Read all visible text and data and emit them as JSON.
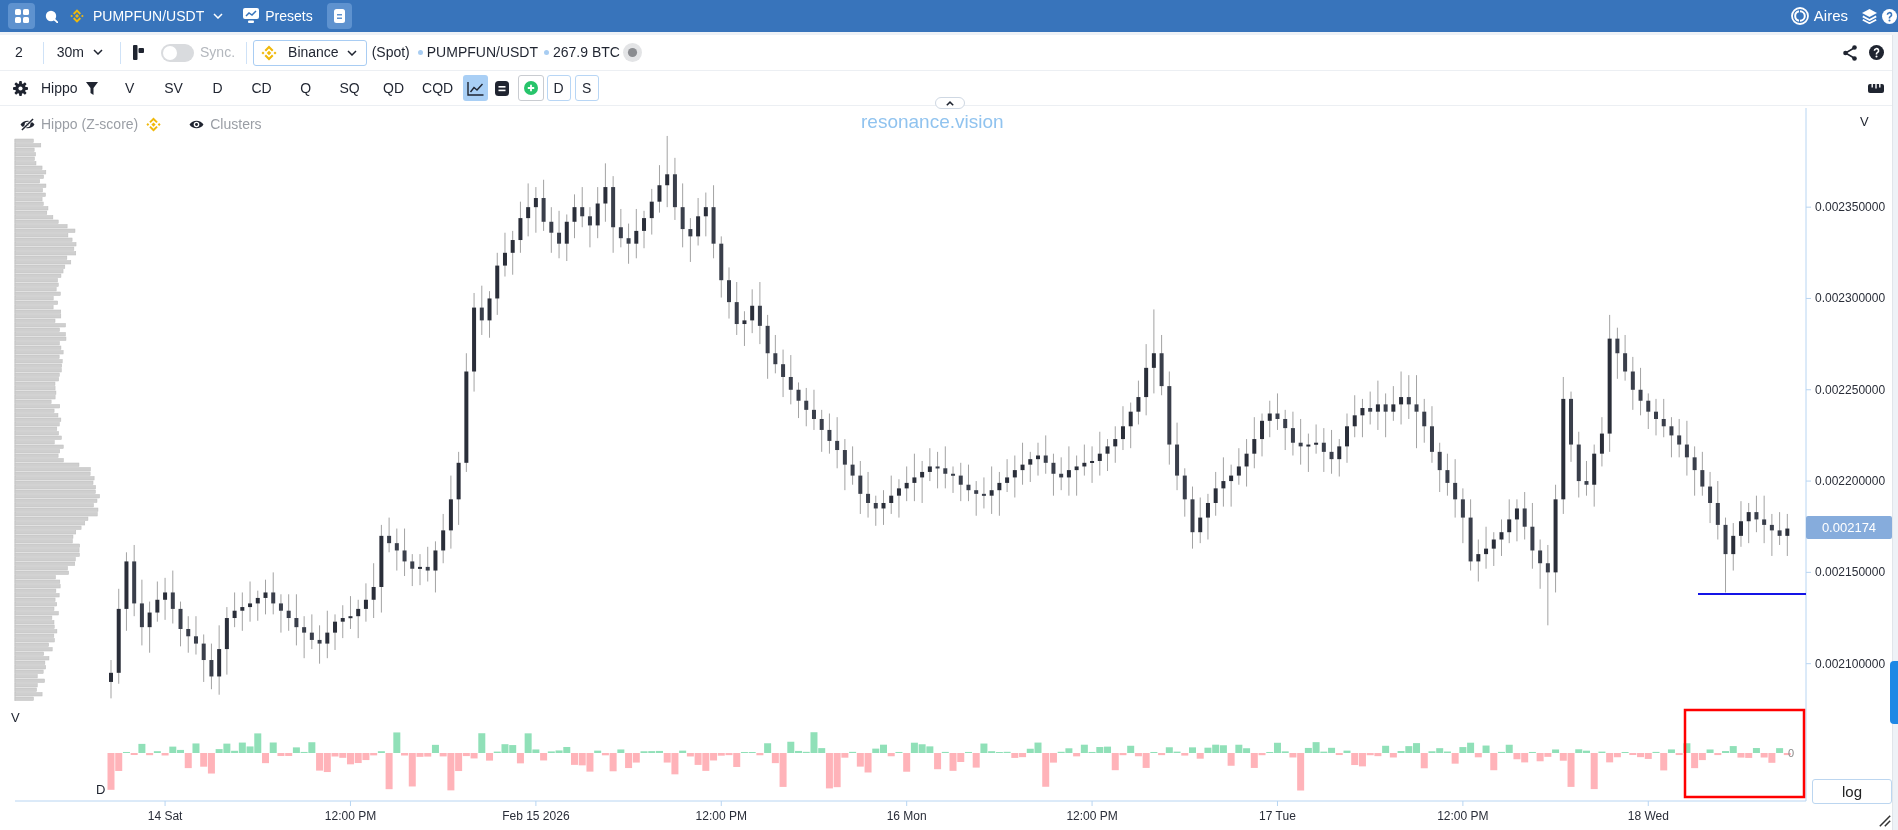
{
  "top_bar": {
    "symbol": "PUMPFUN/USDT",
    "presets": "Presets",
    "user": "Aires"
  },
  "toolbar": {
    "layout_count": "2",
    "interval": "30m",
    "sync": {
      "label": "Sync.",
      "on": false
    },
    "exchange": "Binance",
    "market": "(Spot)",
    "pair": "PUMPFUN/USDT",
    "volume": "267.9 BTC"
  },
  "indicator_bar": {
    "preset": "Hippo",
    "metrics": [
      {
        "label": "V",
        "selected": false
      },
      {
        "label": "SV",
        "selected": false
      },
      {
        "label": "D",
        "selected": false
      },
      {
        "label": "CD",
        "selected": false
      },
      {
        "label": "Q",
        "selected": false
      },
      {
        "label": "SQ",
        "selected": false
      },
      {
        "label": "QD",
        "selected": false
      },
      {
        "label": "CQD",
        "selected": false
      }
    ],
    "line_chart_selected": true,
    "pane_buttons": [
      "D",
      "S"
    ]
  },
  "chart": {
    "legend": [
      {
        "label": "Hippo (Z-score)",
        "visible": false,
        "exchange_logo": true
      },
      {
        "label": "Clusters",
        "visible": true,
        "exchange_logo": false
      }
    ],
    "brand": "resonance.vision",
    "price_scale_label": "V",
    "last_price": "0.002174",
    "profile_label": "V",
    "delta_label": "D",
    "delta_zero": "0",
    "scale_button": "log",
    "chart_data": {
      "type": "candlestick",
      "ylim": [
        0.0020248,
        0.0024043
      ],
      "yticks": [
        {
          "value": 0.00235,
          "label": "0.002350000"
        },
        {
          "value": 0.0023,
          "label": "0.002300000"
        },
        {
          "value": 0.00225,
          "label": "0.002250000"
        },
        {
          "value": 0.0022,
          "label": "0.002200000"
        },
        {
          "value": 0.00215,
          "label": "0.002150000"
        },
        {
          "value": 0.0021,
          "label": "0.002100000"
        }
      ],
      "categories": [
        null,
        null,
        null,
        null,
        null,
        null,
        null,
        "14 Sat",
        null,
        null,
        null,
        null,
        null,
        null,
        null,
        null,
        null,
        null,
        null,
        null,
        null,
        null,
        null,
        null,
        null,
        null,
        null,
        null,
        null,
        null,
        null,
        "12:00 PM",
        null,
        null,
        null,
        null,
        null,
        null,
        null,
        null,
        null,
        null,
        null,
        null,
        null,
        null,
        null,
        null,
        null,
        null,
        null,
        null,
        null,
        null,
        null,
        "Feb 15 2026",
        null,
        null,
        null,
        null,
        null,
        null,
        null,
        null,
        null,
        null,
        null,
        null,
        null,
        null,
        null,
        null,
        null,
        null,
        null,
        null,
        null,
        null,
        null,
        "12:00 PM",
        null,
        null,
        null,
        null,
        null,
        null,
        null,
        null,
        null,
        null,
        null,
        null,
        null,
        null,
        null,
        null,
        null,
        null,
        null,
        null,
        null,
        null,
        null,
        "16 Mon",
        null,
        null,
        null,
        null,
        null,
        null,
        null,
        null,
        null,
        null,
        null,
        null,
        null,
        null,
        null,
        null,
        null,
        null,
        null,
        null,
        null,
        null,
        null,
        "12:00 PM",
        null,
        null,
        null,
        null,
        null,
        null,
        null,
        null,
        null,
        null,
        null,
        null,
        null,
        null,
        null,
        null,
        null,
        null,
        null,
        null,
        null,
        null,
        null,
        "17 Tue",
        null,
        null,
        null,
        null,
        null,
        null,
        null,
        null,
        null,
        null,
        null,
        null,
        null,
        null,
        null,
        null,
        null,
        null,
        null,
        null,
        null,
        null,
        null,
        "12:00 PM",
        null,
        null,
        null,
        null,
        null,
        null,
        null,
        null,
        null,
        null,
        null,
        null,
        null,
        null,
        null,
        null,
        null,
        null,
        null,
        null,
        null,
        null,
        null,
        "18 Wed",
        null,
        null,
        null,
        null,
        null,
        null,
        null,
        null,
        null,
        null,
        null,
        null,
        null,
        null,
        null,
        null,
        null,
        null
      ],
      "ohlc": [
        [
          0.00209,
          0.002102,
          0.002081,
          0.002095
        ],
        [
          0.002095,
          0.002141,
          0.002089,
          0.00213
        ],
        [
          0.00213,
          0.002161,
          0.002118,
          0.002156
        ],
        [
          0.002156,
          0.002165,
          0.002126,
          0.002133
        ],
        [
          0.002133,
          0.002146,
          0.00211,
          0.00212
        ],
        [
          0.00212,
          0.002134,
          0.002106,
          0.002128
        ],
        [
          0.002128,
          0.002145,
          0.002123,
          0.002135
        ],
        [
          0.002135,
          0.002147,
          0.002124,
          0.002139
        ],
        [
          0.002139,
          0.002151,
          0.002122,
          0.00213
        ],
        [
          0.00213,
          0.002134,
          0.0021095,
          0.002119
        ],
        [
          0.002119,
          0.002126,
          0.002106,
          0.002115
        ],
        [
          0.002115,
          0.002126,
          0.002105,
          0.002111
        ],
        [
          0.002111,
          0.002116,
          0.00209,
          0.002102
        ],
        [
          0.002102,
          0.002111,
          0.002086,
          0.002093
        ],
        [
          0.002093,
          0.002121,
          0.002083,
          0.002108
        ],
        [
          0.002108,
          0.002131,
          0.002094,
          0.002125
        ],
        [
          0.002125,
          0.002139,
          0.00212,
          0.002129
        ],
        [
          0.002129,
          0.002139,
          0.002118,
          0.002131
        ],
        [
          0.002131,
          0.002145,
          0.002123,
          0.002133
        ],
        [
          0.002133,
          0.00214,
          0.0021235,
          0.002136
        ],
        [
          0.002136,
          0.002146,
          0.002127,
          0.002139
        ],
        [
          0.002139,
          0.00215,
          0.002127,
          0.002133
        ],
        [
          0.002133,
          0.002138,
          0.002117,
          0.002129
        ],
        [
          0.002129,
          0.002138,
          0.002118,
          0.002125
        ],
        [
          0.002125,
          0.002138,
          0.00211,
          0.00212
        ],
        [
          0.00212,
          0.002126,
          0.002103,
          0.002117
        ],
        [
          0.002117,
          0.002127,
          0.002108,
          0.002113
        ],
        [
          0.002113,
          0.002121,
          0.0021,
          0.002111
        ],
        [
          0.002111,
          0.002129,
          0.002103,
          0.002117
        ],
        [
          0.002117,
          0.002127,
          0.0021075,
          0.002123
        ],
        [
          0.002123,
          0.002132,
          0.002114,
          0.002125
        ],
        [
          0.002125,
          0.002137,
          0.002119,
          0.002126
        ],
        [
          0.002126,
          0.002135,
          0.002114,
          0.00213
        ],
        [
          0.00213,
          0.002144,
          0.002123,
          0.002135
        ],
        [
          0.002135,
          0.002155,
          0.002125,
          0.002142
        ],
        [
          0.002142,
          0.002176,
          0.002128,
          0.00217
        ],
        [
          0.00217,
          0.00218,
          0.002161,
          0.002166
        ],
        [
          0.002166,
          0.002174,
          0.002151,
          0.002162
        ],
        [
          0.002162,
          0.002174,
          0.002148,
          0.002156
        ],
        [
          0.002156,
          0.00216,
          0.0021425,
          0.002152
        ],
        [
          0.002152,
          0.00216,
          0.002143,
          0.002153
        ],
        [
          0.002153,
          0.002164,
          0.002145,
          0.002151
        ],
        [
          0.002151,
          0.002167,
          0.002139,
          0.002162
        ],
        [
          0.002162,
          0.002182,
          0.002155,
          0.002173
        ],
        [
          0.002173,
          0.002203,
          0.002163,
          0.00219
        ],
        [
          0.00219,
          0.002216,
          0.002176,
          0.00221
        ],
        [
          0.00221,
          0.00227,
          0.002205,
          0.00226
        ],
        [
          0.00226,
          0.002303,
          0.002249,
          0.002295
        ],
        [
          0.002295,
          0.002307,
          0.00228,
          0.002288
        ],
        [
          0.002288,
          0.002304,
          0.0022785,
          0.0023
        ],
        [
          0.0023,
          0.002325,
          0.002291,
          0.002318
        ],
        [
          0.002318,
          0.002336,
          0.002312,
          0.002325
        ],
        [
          0.002325,
          0.002337,
          0.002313,
          0.002332
        ],
        [
          0.002332,
          0.002353,
          0.002325,
          0.002344
        ],
        [
          0.002344,
          0.002363,
          0.002334,
          0.00235
        ],
        [
          0.00235,
          0.002361,
          0.002336,
          0.002355
        ],
        [
          0.002355,
          0.002365,
          0.002337,
          0.002342
        ],
        [
          0.002342,
          0.00235,
          0.002325,
          0.002336
        ],
        [
          0.002336,
          0.002348,
          0.002322,
          0.00233
        ],
        [
          0.00233,
          0.002346,
          0.0023205,
          0.002342
        ],
        [
          0.002342,
          0.002357,
          0.002333,
          0.00235
        ],
        [
          0.00235,
          0.002361,
          0.002339,
          0.002345
        ],
        [
          0.002345,
          0.00235,
          0.002328,
          0.00234
        ],
        [
          0.00234,
          0.002361,
          0.002333,
          0.002352
        ],
        [
          0.002352,
          0.002374,
          0.002342,
          0.002361
        ],
        [
          0.002361,
          0.002367,
          0.002325,
          0.002339
        ],
        [
          0.002339,
          0.002349,
          0.002328,
          0.002333
        ],
        [
          0.002333,
          0.002341,
          0.002319,
          0.00233
        ],
        [
          0.00233,
          0.002349,
          0.002322,
          0.002337
        ],
        [
          0.002337,
          0.002348,
          0.0023275,
          0.002344
        ],
        [
          0.002344,
          0.00236,
          0.002335,
          0.002353
        ],
        [
          0.002353,
          0.002373,
          0.002347,
          0.002362
        ],
        [
          0.002362,
          0.002389,
          0.00235,
          0.002368
        ],
        [
          0.002368,
          0.002377,
          0.002343,
          0.00235
        ],
        [
          0.00235,
          0.002363,
          0.002328,
          0.002338
        ],
        [
          0.002338,
          0.002344,
          0.00232,
          0.002334
        ],
        [
          0.002334,
          0.002355,
          0.002329,
          0.002345
        ],
        [
          0.002345,
          0.002358,
          0.002334,
          0.00235
        ],
        [
          0.00235,
          0.002362,
          0.002322,
          0.00233
        ],
        [
          0.00233,
          0.002334,
          0.0023005,
          0.00231
        ],
        [
          0.00231,
          0.002317,
          0.002289,
          0.002298
        ],
        [
          0.002298,
          0.002309,
          0.00228,
          0.002286
        ],
        [
          0.002286,
          0.002293,
          0.002274,
          0.002288
        ],
        [
          0.002288,
          0.002305,
          0.002281,
          0.002296
        ],
        [
          0.002296,
          0.002309,
          0.002275,
          0.002285
        ],
        [
          0.002285,
          0.002291,
          0.002256,
          0.00227
        ],
        [
          0.00227,
          0.00228,
          0.002259,
          0.002264
        ],
        [
          0.002264,
          0.002272,
          0.002246,
          0.002257
        ],
        [
          0.002257,
          0.002269,
          0.002242,
          0.00225
        ],
        [
          0.00225,
          0.002254,
          0.0022345,
          0.002244
        ],
        [
          0.002244,
          0.002251,
          0.00223,
          0.002239
        ],
        [
          0.002239,
          0.00225,
          0.002228,
          0.002234
        ],
        [
          0.002234,
          0.002239,
          0.002216,
          0.002228
        ],
        [
          0.002228,
          0.002237,
          0.002215,
          0.002222
        ],
        [
          0.002222,
          0.002235,
          0.002207,
          0.002217
        ],
        [
          0.002217,
          0.002223,
          0.002195,
          0.002209
        ],
        [
          0.002209,
          0.002219,
          0.002198,
          0.002203
        ],
        [
          0.002203,
          0.002211,
          0.002182,
          0.002193
        ],
        [
          0.002193,
          0.002205,
          0.00218,
          0.002188
        ],
        [
          0.002188,
          0.002192,
          0.0021755,
          0.002185
        ],
        [
          0.002185,
          0.002195,
          0.002176,
          0.002188
        ],
        [
          0.002188,
          0.002203,
          0.002182,
          0.002192
        ],
        [
          0.002192,
          0.002201,
          0.00218,
          0.002196
        ],
        [
          0.002196,
          0.002208,
          0.002189,
          0.002199
        ],
        [
          0.002199,
          0.002215,
          0.002189,
          0.002202
        ],
        [
          0.002202,
          0.002211,
          0.002188,
          0.002205
        ],
        [
          0.002205,
          0.002218,
          0.0022,
          0.002208
        ],
        [
          0.002208,
          0.002216,
          0.002196,
          0.002207
        ],
        [
          0.002207,
          0.002219,
          0.002196,
          0.002204
        ],
        [
          0.002204,
          0.002208,
          0.0021935,
          0.002203
        ],
        [
          0.002203,
          0.00221,
          0.002189,
          0.002198
        ],
        [
          0.002198,
          0.002209,
          0.002189,
          0.002195
        ],
        [
          0.002195,
          0.0022,
          0.002181,
          0.002193
        ],
        [
          0.002193,
          0.002202,
          0.002185,
          0.002192
        ],
        [
          0.002192,
          0.002208,
          0.002182,
          0.002195
        ],
        [
          0.002195,
          0.002205,
          0.002181,
          0.002199
        ],
        [
          0.002199,
          0.002212,
          0.002194,
          0.002202
        ],
        [
          0.002202,
          0.002214,
          0.002191,
          0.002206
        ],
        [
          0.002206,
          0.002221,
          0.002198,
          0.002209
        ],
        [
          0.002209,
          0.002216,
          0.0021995,
          0.002212
        ],
        [
          0.002212,
          0.002221,
          0.002203,
          0.002214
        ],
        [
          0.002214,
          0.002225,
          0.002204,
          0.00221
        ],
        [
          0.00221,
          0.002215,
          0.002192,
          0.002204
        ],
        [
          0.002204,
          0.002213,
          0.002195,
          0.002202
        ],
        [
          0.002202,
          0.002219,
          0.002192,
          0.002206
        ],
        [
          0.002206,
          0.002214,
          0.002192,
          0.002208
        ],
        [
          0.002208,
          0.00222,
          0.002203,
          0.00221
        ],
        [
          0.00221,
          0.002219,
          0.002199,
          0.002211
        ],
        [
          0.002211,
          0.002227,
          0.002203,
          0.002215
        ],
        [
          0.002215,
          0.002223,
          0.0022055,
          0.002219
        ],
        [
          0.002219,
          0.00223,
          0.00221,
          0.002223
        ],
        [
          0.002223,
          0.002241,
          0.002217,
          0.00223
        ],
        [
          0.00223,
          0.002243,
          0.002218,
          0.002238
        ],
        [
          0.002238,
          0.002255,
          0.002231,
          0.002246
        ],
        [
          0.002246,
          0.002275,
          0.002236,
          0.002262
        ],
        [
          0.002262,
          0.002294,
          0.002248,
          0.00227
        ],
        [
          0.00227,
          0.00228,
          0.002247,
          0.002252
        ],
        [
          0.002252,
          0.00226,
          0.002209,
          0.00222
        ],
        [
          0.00222,
          0.002232,
          0.002195,
          0.002203
        ],
        [
          0.002203,
          0.002207,
          0.0021805,
          0.00219
        ],
        [
          0.00219,
          0.002197,
          0.002163,
          0.002172
        ],
        [
          0.002172,
          0.002191,
          0.002166,
          0.00218
        ],
        [
          0.00218,
          0.002193,
          0.002168,
          0.002188
        ],
        [
          0.002188,
          0.002205,
          0.002181,
          0.002196
        ],
        [
          0.002196,
          0.002213,
          0.002186,
          0.0022
        ],
        [
          0.0022,
          0.002209,
          0.002186,
          0.002203
        ],
        [
          0.002203,
          0.002218,
          0.002198,
          0.002208
        ],
        [
          0.002208,
          0.002223,
          0.002197,
          0.002215
        ],
        [
          0.002215,
          0.002235,
          0.002207,
          0.002223
        ],
        [
          0.002223,
          0.002237,
          0.0022135,
          0.002233
        ],
        [
          0.002233,
          0.002244,
          0.002224,
          0.002237
        ],
        [
          0.002237,
          0.002248,
          0.002228,
          0.002234
        ],
        [
          0.002234,
          0.002239,
          0.002217,
          0.002229
        ],
        [
          0.002229,
          0.002238,
          0.002214,
          0.002221
        ],
        [
          0.002221,
          0.002234,
          0.002209,
          0.002219
        ],
        [
          0.002219,
          0.002226,
          0.002205,
          0.00222
        ],
        [
          0.00222,
          0.002231,
          0.002215,
          0.002221
        ],
        [
          0.002221,
          0.002229,
          0.002205,
          0.002216
        ],
        [
          0.002216,
          0.002228,
          0.002204,
          0.002212
        ],
        [
          0.002212,
          0.002223,
          0.0022025,
          0.002219
        ],
        [
          0.002219,
          0.002237,
          0.00221,
          0.00223
        ],
        [
          0.00223,
          0.002247,
          0.002224,
          0.002236
        ],
        [
          0.002236,
          0.002245,
          0.002224,
          0.00224
        ],
        [
          0.00224,
          0.002249,
          0.002231,
          0.002238
        ],
        [
          0.002238,
          0.002255,
          0.002228,
          0.002242
        ],
        [
          0.002242,
          0.002248,
          0.002224,
          0.002238
        ],
        [
          0.002238,
          0.002252,
          0.002233,
          0.002242
        ],
        [
          0.002242,
          0.00226,
          0.002231,
          0.002246
        ],
        [
          0.002246,
          0.002258,
          0.002234,
          0.002242
        ],
        [
          0.002242,
          0.002258,
          0.002218,
          0.002238
        ],
        [
          0.002238,
          0.002245,
          0.002221,
          0.00223
        ],
        [
          0.00223,
          0.002241,
          0.00221,
          0.002216
        ],
        [
          0.002216,
          0.002221,
          0.002194,
          0.002206
        ],
        [
          0.002206,
          0.002215,
          0.002192,
          0.002199
        ],
        [
          0.002199,
          0.002212,
          0.00218,
          0.00219
        ],
        [
          0.00219,
          0.002196,
          0.002166,
          0.00218
        ],
        [
          0.00218,
          0.00219,
          0.002151,
          0.002156
        ],
        [
          0.002156,
          0.002168,
          0.002145,
          0.00216
        ],
        [
          0.00216,
          0.002175,
          0.002152,
          0.002163
        ],
        [
          0.002163,
          0.002172,
          0.0021535,
          0.002168
        ],
        [
          0.002168,
          0.002179,
          0.002159,
          0.002172
        ],
        [
          0.002172,
          0.00219,
          0.002166,
          0.002179
        ],
        [
          0.002179,
          0.00219,
          0.002167,
          0.002185
        ],
        [
          0.002185,
          0.002194,
          0.002168,
          0.002175
        ],
        [
          0.002175,
          0.002188,
          0.002152,
          0.002162
        ],
        [
          0.002162,
          0.002168,
          0.002141,
          0.002155
        ],
        [
          0.002155,
          0.002165,
          0.002121,
          0.00215
        ],
        [
          0.00215,
          0.002198,
          0.002139,
          0.00219
        ],
        [
          0.00219,
          0.002257,
          0.002182,
          0.002245
        ],
        [
          0.002245,
          0.002249,
          0.0022105,
          0.00222
        ],
        [
          0.00222,
          0.002227,
          0.002191,
          0.0022
        ],
        [
          0.0022,
          0.002211,
          0.002192,
          0.002198
        ],
        [
          0.002198,
          0.00222,
          0.002186,
          0.002215
        ],
        [
          0.002215,
          0.002235,
          0.002208,
          0.002226
        ],
        [
          0.002226,
          0.002291,
          0.002216,
          0.002278
        ],
        [
          0.002278,
          0.002284,
          0.002256,
          0.00227
        ],
        [
          0.00227,
          0.00228,
          0.002255,
          0.00226
        ],
        [
          0.00226,
          0.002268,
          0.002239,
          0.00225
        ],
        [
          0.00225,
          0.002262,
          0.002236,
          0.002244
        ],
        [
          0.002244,
          0.002248,
          0.0022285,
          0.002238
        ],
        [
          0.002238,
          0.002245,
          0.002225,
          0.002234
        ],
        [
          0.002234,
          0.002245,
          0.002224,
          0.00223
        ],
        [
          0.00223,
          0.002235,
          0.002213,
          0.002225
        ],
        [
          0.002225,
          0.002234,
          0.002213,
          0.00222
        ],
        [
          0.00222,
          0.002233,
          0.002203,
          0.002213
        ],
        [
          0.002213,
          0.002219,
          0.002192,
          0.002206
        ],
        [
          0.002206,
          0.002216,
          0.002192,
          0.002197
        ],
        [
          0.002197,
          0.002205,
          0.002177,
          0.002188
        ],
        [
          0.002188,
          0.0022,
          0.002168,
          0.002176
        ],
        [
          0.002176,
          0.00218,
          0.002139,
          0.00216
        ],
        [
          0.00216,
          0.002177,
          0.002151,
          0.00217
        ],
        [
          0.00217,
          0.002189,
          0.002164,
          0.002178
        ],
        [
          0.002178,
          0.002188,
          0.002166,
          0.002183
        ],
        [
          0.002183,
          0.002192,
          0.002172,
          0.002179
        ],
        [
          0.002179,
          0.002192,
          0.002166,
          0.002176
        ],
        [
          0.002176,
          0.002182,
          0.002159,
          0.002173
        ],
        [
          0.002173,
          0.002183,
          0.002165,
          0.00217
        ],
        [
          0.00217,
          0.002182,
          0.002159,
          0.002174
        ]
      ]
    }
  }
}
